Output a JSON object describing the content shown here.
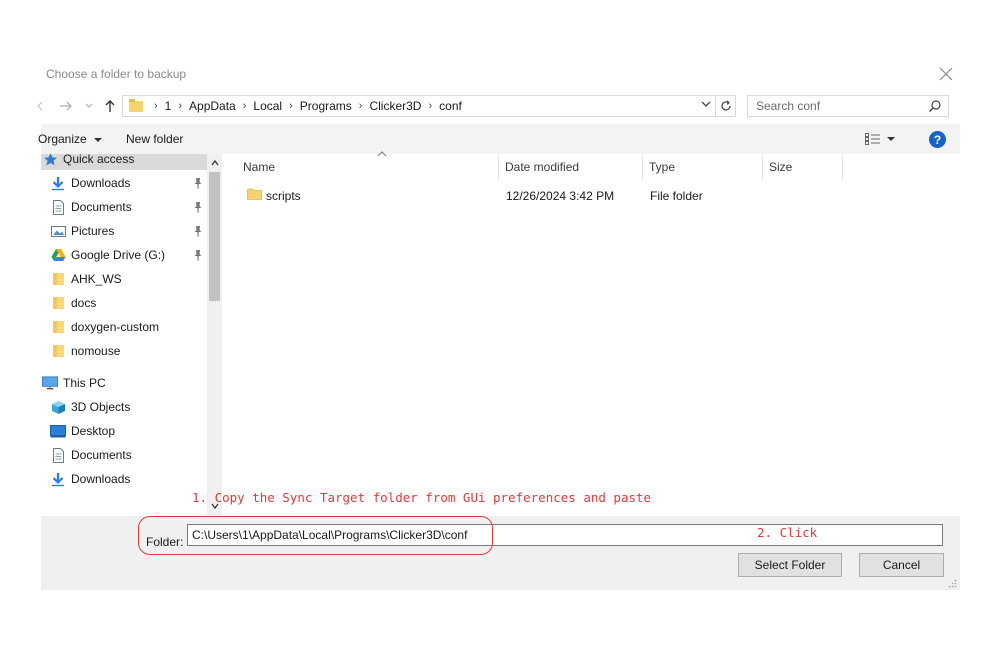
{
  "window": {
    "title": "Choose a folder to backup"
  },
  "nav": {
    "back_icon": "back-arrow-icon",
    "forward_icon": "forward-arrow-icon",
    "recent_icon": "chevron-down-icon",
    "up_icon": "up-arrow-icon"
  },
  "address": {
    "crumbs": [
      "1",
      "AppData",
      "Local",
      "Programs",
      "Clicker3D",
      "conf"
    ]
  },
  "search": {
    "placeholder": "Search conf"
  },
  "toolbar": {
    "organize_label": "Organize",
    "new_folder_label": "New folder"
  },
  "sidebar": {
    "items": [
      {
        "label": "Quick access",
        "icon": "star-icon",
        "pinned": false,
        "selected": true
      },
      {
        "label": "Downloads",
        "icon": "download-icon",
        "pinned": true
      },
      {
        "label": "Documents",
        "icon": "document-icon",
        "pinned": true
      },
      {
        "label": "Pictures",
        "icon": "pictures-icon",
        "pinned": true
      },
      {
        "label": "Google Drive (G:)",
        "icon": "google-drive-icon",
        "pinned": true
      },
      {
        "label": "AHK_WS",
        "icon": "folder-icon",
        "pinned": false
      },
      {
        "label": "docs",
        "icon": "folder-icon",
        "pinned": false
      },
      {
        "label": "doxygen-custom",
        "icon": "folder-icon",
        "pinned": false
      },
      {
        "label": "nomouse",
        "icon": "folder-icon",
        "pinned": false
      },
      {
        "label": "This PC",
        "icon": "computer-icon",
        "pinned": false
      },
      {
        "label": "3D Objects",
        "icon": "cube-icon",
        "pinned": false
      },
      {
        "label": "Desktop",
        "icon": "desktop-icon",
        "pinned": false
      },
      {
        "label": "Documents",
        "icon": "document-icon",
        "pinned": false
      },
      {
        "label": "Downloads",
        "icon": "download-icon",
        "pinned": false
      }
    ]
  },
  "filelist": {
    "columns": [
      "Name",
      "Date modified",
      "Type",
      "Size"
    ],
    "rows": [
      {
        "name": "scripts",
        "date_modified": "12/26/2024 3:42 PM",
        "type": "File folder",
        "size": ""
      }
    ]
  },
  "footer": {
    "folder_label": "Folder:",
    "folder_value": "C:\\Users\\1\\AppData\\Local\\Programs\\Clicker3D\\conf",
    "select_label": "Select Folder",
    "cancel_label": "Cancel"
  },
  "annotations": {
    "step1": "1. Copy the Sync Target folder from GUi preferences and paste",
    "step2": "2. Click",
    "color": "#e03b3b"
  },
  "colors": {
    "selection": "#d9d9d9",
    "folder": "#f6d36b",
    "help_blue": "#1464c8"
  }
}
